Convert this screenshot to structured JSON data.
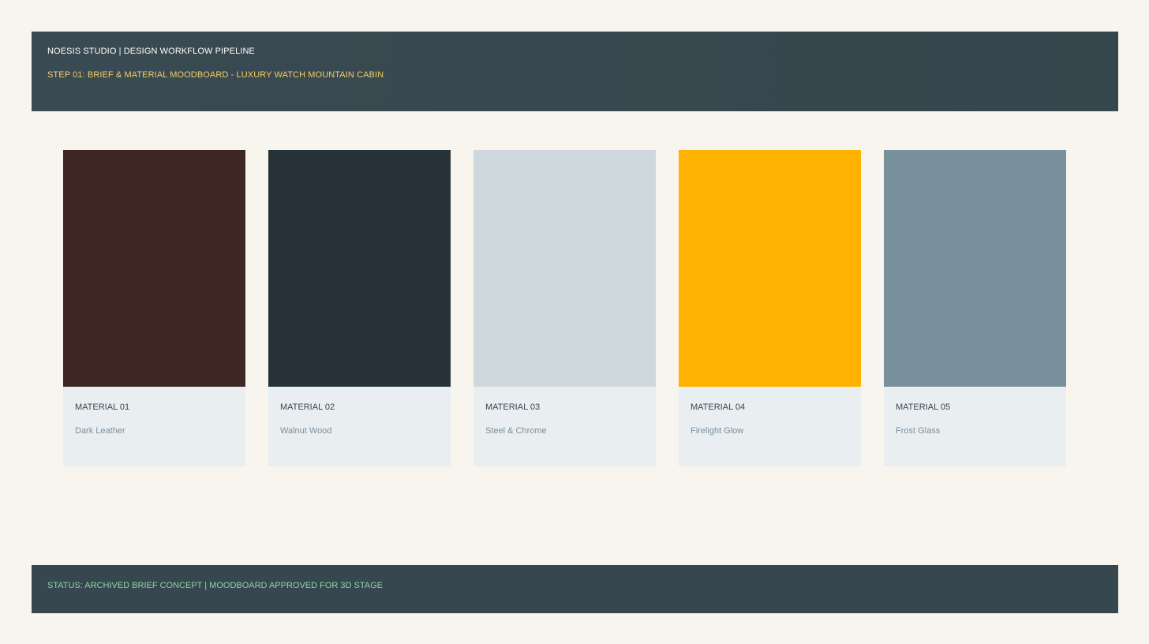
{
  "header": {
    "title": "NOESIS STUDIO | DESIGN WORKFLOW PIPELINE",
    "step": "STEP 01: BRIEF & MATERIAL MOODBOARD - LUXURY WATCH MOUNTAIN CABIN"
  },
  "materials": [
    {
      "number": "MATERIAL 01",
      "name": "Dark Leather",
      "color": "#3e2723"
    },
    {
      "number": "MATERIAL 02",
      "name": "Walnut Wood",
      "color": "#263238"
    },
    {
      "number": "MATERIAL 03",
      "name": "Steel & Chrome",
      "color": "#cfd8dc"
    },
    {
      "number": "MATERIAL 04",
      "name": "Firelight Glow",
      "color": "#ffb300"
    },
    {
      "number": "MATERIAL 05",
      "name": "Frost Glass",
      "color": "#78909c"
    }
  ],
  "footer": {
    "status": "STATUS: ARCHIVED BRIEF CONCEPT | MOODBOARD APPROVED FOR 3D STAGE"
  },
  "colors": {
    "background": "#f7f5ee",
    "header_bg": "#37474f",
    "step_accent": "#f2cf63",
    "status_accent": "#8fd4a0",
    "card_bg": "#e9eef1"
  }
}
